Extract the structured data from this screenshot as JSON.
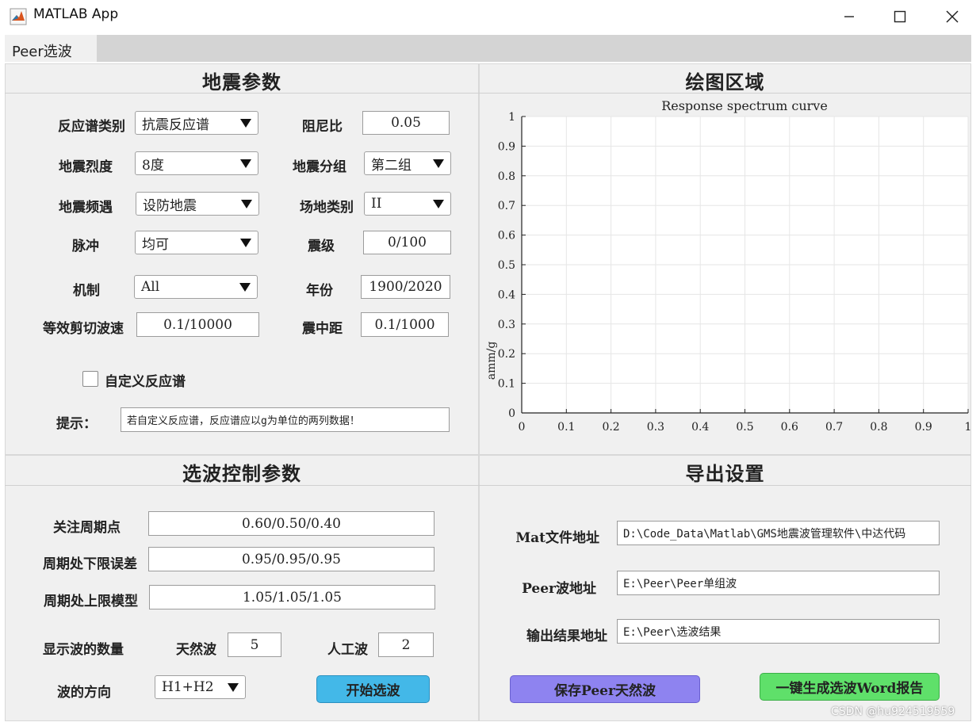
{
  "window": {
    "title": "MATLAB App"
  },
  "menu": {
    "peer": "Peer选波"
  },
  "seismic": {
    "title": "地震参数",
    "spectrum_type": {
      "label": "反应谱类别",
      "value": "抗震反应谱"
    },
    "damping": {
      "label": "阻尼比",
      "value": "0.05"
    },
    "intensity": {
      "label": "地震烈度",
      "value": "8度"
    },
    "group": {
      "label": "地震分组",
      "value": "第二组"
    },
    "frequency": {
      "label": "地震频遇",
      "value": "设防地震"
    },
    "site": {
      "label": "场地类别",
      "value": "II"
    },
    "pulse": {
      "label": "脉冲",
      "value": "均可"
    },
    "magnitude": {
      "label": "震级",
      "value": "0/100"
    },
    "mechanism": {
      "label": "机制",
      "value": "All"
    },
    "year": {
      "label": "年份",
      "value": "1900/2020"
    },
    "shear_velocity": {
      "label": "等效剪切波速",
      "value": "0.1/10000"
    },
    "epicentral": {
      "label": "震中距",
      "value": "0.1/1000"
    },
    "custom_spectrum": {
      "label": "自定义反应谱",
      "checked": false
    },
    "hint": {
      "label": "提示：",
      "value": "若自定义反应谱，反应谱应以g为单位的两列数据！"
    }
  },
  "plot": {
    "panel_title": "绘图区域",
    "chart_data": {
      "type": "line",
      "title": "Response spectrum curve",
      "xlabel": "",
      "ylabel": "amm/g",
      "xlim": [
        0,
        1
      ],
      "ylim": [
        0,
        1
      ],
      "xticks": [
        "0",
        "0.1",
        "0.2",
        "0.3",
        "0.4",
        "0.5",
        "0.6",
        "0.7",
        "0.8",
        "0.9",
        "1"
      ],
      "yticks": [
        "0",
        "0.1",
        "0.2",
        "0.3",
        "0.4",
        "0.5",
        "0.6",
        "0.7",
        "0.8",
        "0.9",
        "1"
      ],
      "grid": true,
      "series": []
    }
  },
  "selection": {
    "title": "选波控制参数",
    "focus_period": {
      "label": "关注周期点",
      "value": "0.60/0.50/0.40"
    },
    "lower_error": {
      "label": "周期处下限误差",
      "value": "0.95/0.95/0.95"
    },
    "upper_model": {
      "label": "周期处上限模型",
      "value": "1.05/1.05/1.05"
    },
    "count_label": "显示波的数量",
    "natural": {
      "label": "天然波",
      "value": "5"
    },
    "artificial": {
      "label": "人工波",
      "value": "2"
    },
    "direction": {
      "label": "波的方向",
      "value": "H1+H2"
    },
    "start_button": "开始选波"
  },
  "export": {
    "title": "导出设置",
    "mat_path": {
      "label": "Mat文件地址",
      "value": "D:\\Code_Data\\Matlab\\GMS地震波管理软件\\中达代码"
    },
    "peer_path": {
      "label": "Peer波地址",
      "value": "E:\\Peer\\Peer单组波"
    },
    "output_path": {
      "label": "输出结果地址",
      "value": "E:\\Peer\\选波结果"
    },
    "save_button": "保存Peer天然波",
    "report_button": "一键生成选波Word报告"
  },
  "watermark": "CSDN @hu924519559",
  "colors": {
    "start_button": "#43b8e8",
    "save_button": "#8e83f0",
    "report_button": "#5fe06a"
  }
}
